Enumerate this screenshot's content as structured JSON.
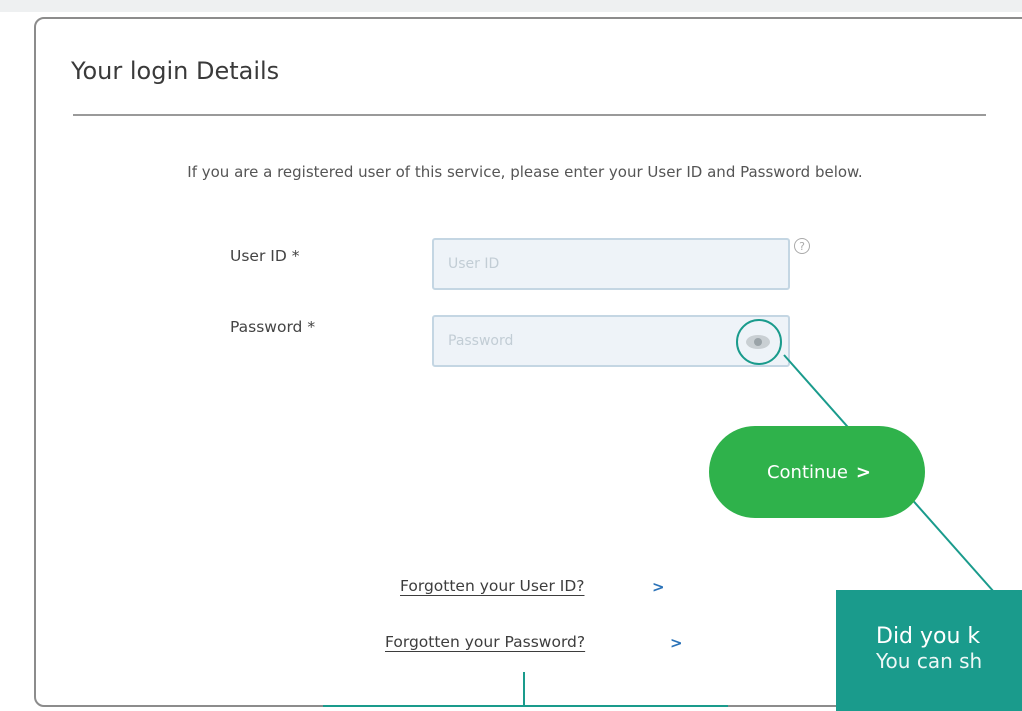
{
  "form": {
    "title": "Your login Details",
    "intro": "If you are a registered user of this service, please enter your User ID and Password below.",
    "user_id_label": "User ID *",
    "user_id_placeholder": "User ID",
    "password_label": "Password *",
    "password_placeholder": "Password",
    "continue_label": "Continue",
    "continue_chevron": ">",
    "forgot_user_id": "Forgotten your User ID?",
    "forgot_password": "Forgotten your Password?",
    "link_chevron": ">"
  },
  "icons": {
    "help": "?",
    "show_password": "eye-icon"
  },
  "tooltip": {
    "title": "Did you k",
    "body": "You can sh"
  },
  "colors": {
    "accent_green": "#2fb24b",
    "callout_teal": "#1a9b8c",
    "link_blue": "#2a72b8",
    "input_bg": "#eef3f8",
    "input_border": "#c4d6e3"
  }
}
